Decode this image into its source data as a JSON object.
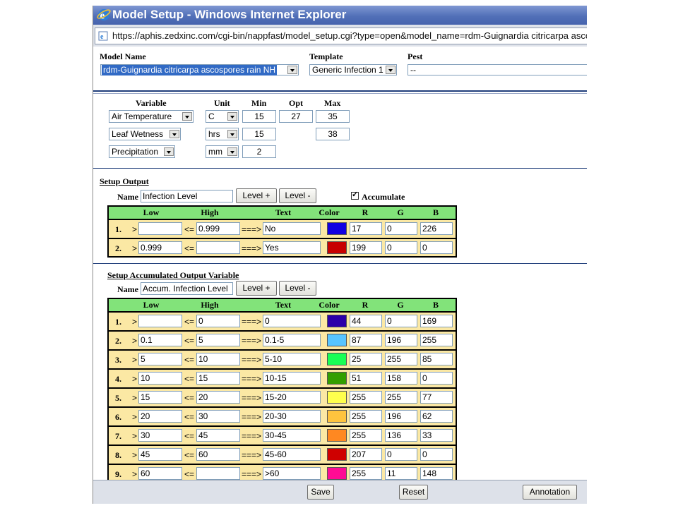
{
  "window": {
    "title": "Model Setup - Windows Internet Explorer",
    "url": "https://aphis.zedxinc.com/cgi-bin/nappfast/model_setup.cgi?type=open&model_name=rdm-Guignardia citricarpa ascospores rain NH"
  },
  "top": {
    "model_name_label": "Model Name",
    "model_name_value": "rdm-Guignardia citricarpa ascospores rain NH",
    "template_label": "Template",
    "template_value": "Generic Infection 1",
    "pest_label": "Pest",
    "pest_value": "--"
  },
  "variables": {
    "headers": {
      "variable": "Variable",
      "unit": "Unit",
      "min": "Min",
      "opt": "Opt",
      "max": "Max"
    },
    "rows": [
      {
        "variable": "Air Temperature",
        "unit": "C",
        "min": "15",
        "opt": "27",
        "max": "35"
      },
      {
        "variable": "Leaf Wetness",
        "unit": "hrs",
        "min": "15",
        "opt": "",
        "max": "38"
      },
      {
        "variable": "Precipitation",
        "unit": "mm",
        "min": "2",
        "opt": "",
        "max": ""
      }
    ]
  },
  "setup_output": {
    "title": "Setup Output",
    "name_label": "Name",
    "name_value": "Infection Level",
    "level_plus": "Level +",
    "level_minus": "Level -",
    "accumulate_label": "Accumulate",
    "accumulate_checked": true,
    "headers": {
      "low": "Low",
      "high": "High",
      "text": "Text",
      "color": "Color",
      "r": "R",
      "g": "G",
      "b": "B"
    },
    "rows": [
      {
        "num": "1.",
        "gt": ">",
        "low": "",
        "le": "<=",
        "high": "0.999",
        "arrow": "===>",
        "text": "No",
        "color": "#1100e2",
        "r": "17",
        "g": "0",
        "b": "226"
      },
      {
        "num": "2.",
        "gt": ">",
        "low": "0.999",
        "le": "<=",
        "high": "",
        "arrow": "===>",
        "text": "Yes",
        "color": "#c70000",
        "r": "199",
        "g": "0",
        "b": "0"
      }
    ]
  },
  "accum_output": {
    "title": "Setup Accumulated Output Variable",
    "name_label": "Name",
    "name_value": "Accum. Infection Level",
    "level_plus": "Level +",
    "level_minus": "Level -",
    "headers": {
      "low": "Low",
      "high": "High",
      "text": "Text",
      "color": "Color",
      "r": "R",
      "g": "G",
      "b": "B"
    },
    "rows": [
      {
        "num": "1.",
        "gt": ">",
        "low": "",
        "le": "<=",
        "high": "0",
        "arrow": "===>",
        "text": "0",
        "color": "#2c00a9",
        "r": "44",
        "g": "0",
        "b": "169"
      },
      {
        "num": "2.",
        "gt": ">",
        "low": "0.1",
        "le": "<=",
        "high": "5",
        "arrow": "===>",
        "text": "0.1-5",
        "color": "#57c4ff",
        "r": "87",
        "g": "196",
        "b": "255"
      },
      {
        "num": "3.",
        "gt": ">",
        "low": "5",
        "le": "<=",
        "high": "10",
        "arrow": "===>",
        "text": "5-10",
        "color": "#19ff55",
        "r": "25",
        "g": "255",
        "b": "85"
      },
      {
        "num": "4.",
        "gt": ">",
        "low": "10",
        "le": "<=",
        "high": "15",
        "arrow": "===>",
        "text": "10-15",
        "color": "#339e00",
        "r": "51",
        "g": "158",
        "b": "0"
      },
      {
        "num": "5.",
        "gt": ">",
        "low": "15",
        "le": "<=",
        "high": "20",
        "arrow": "===>",
        "text": "15-20",
        "color": "#ffff4d",
        "r": "255",
        "g": "255",
        "b": "77"
      },
      {
        "num": "6.",
        "gt": ">",
        "low": "20",
        "le": "<=",
        "high": "30",
        "arrow": "===>",
        "text": "20-30",
        "color": "#ffc43e",
        "r": "255",
        "g": "196",
        "b": "62"
      },
      {
        "num": "7.",
        "gt": ">",
        "low": "30",
        "le": "<=",
        "high": "45",
        "arrow": "===>",
        "text": "30-45",
        "color": "#ff8821",
        "r": "255",
        "g": "136",
        "b": "33"
      },
      {
        "num": "8.",
        "gt": ">",
        "low": "45",
        "le": "<=",
        "high": "60",
        "arrow": "===>",
        "text": "45-60",
        "color": "#cf0000",
        "r": "207",
        "g": "0",
        "b": "0"
      },
      {
        "num": "9.",
        "gt": ">",
        "low": "60",
        "le": "<=",
        "high": "",
        "arrow": "===>",
        "text": ">60",
        "color": "#ff0b94",
        "r": "255",
        "g": "11",
        "b": "148"
      }
    ]
  },
  "buttons": {
    "save": "Save",
    "reset": "Reset",
    "annotation": "Annotation"
  }
}
